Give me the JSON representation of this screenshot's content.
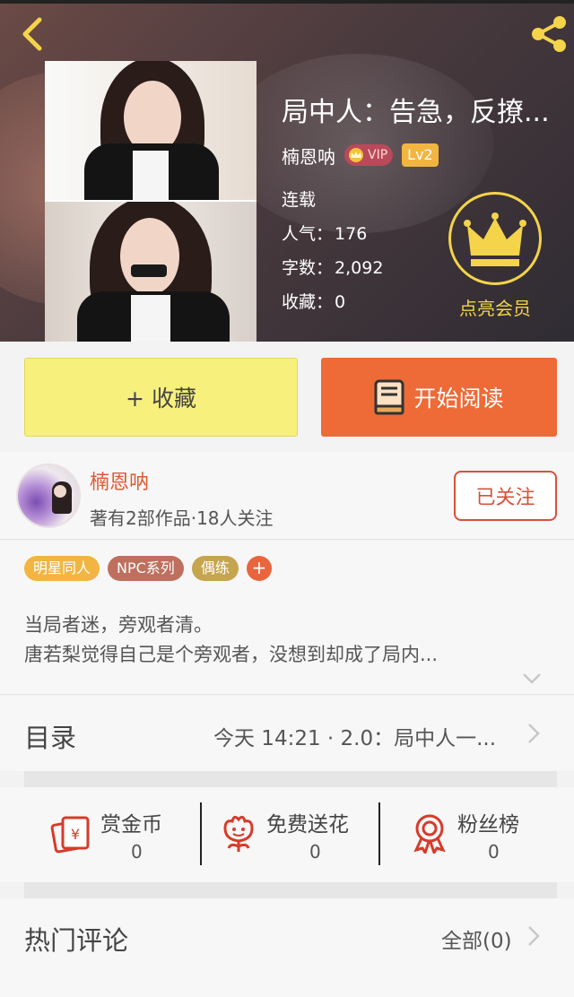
{
  "header": {
    "book_title": "局中人：告急，反撩...",
    "author": "楠恩呐",
    "vip_label": "VIP",
    "level_label": "Lv2",
    "status": "连载",
    "popularity_label": "人气：",
    "popularity_value": "176",
    "words_label": "字数：",
    "words_value": "2,092",
    "favorites_label": "收藏：",
    "favorites_value": "0",
    "member_label": "点亮会员"
  },
  "actions": {
    "favorite_label": "+ 收藏",
    "read_label": "开始阅读"
  },
  "author_card": {
    "name": "楠恩呐",
    "meta": "著有2部作品·18人关注",
    "follow_label": "已关注"
  },
  "tags": [
    "明星同人",
    "NPC系列",
    "偶练"
  ],
  "tag_add_label": "+",
  "intro": {
    "line1": "当局者迷，旁观者清。",
    "line2": "唐若梨觉得自己是个旁观者，没想到却成了局内..."
  },
  "toc": {
    "title": "目录",
    "latest": "今天 14:21 · 2.0：局中人一..."
  },
  "rewards": [
    {
      "label": "赏金币",
      "value": "0",
      "icon": "coin-envelope-icon"
    },
    {
      "label": "免费送花",
      "value": "0",
      "icon": "flower-icon"
    },
    {
      "label": "粉丝榜",
      "value": "0",
      "icon": "medal-icon"
    }
  ],
  "comments": {
    "title": "热门评论",
    "all_label": "全部(0)"
  },
  "colors": {
    "accent_orange": "#ee6a36",
    "favorite_yellow": "#f7f07d",
    "gold": "#f3d44a",
    "link_red": "#e05a34"
  }
}
